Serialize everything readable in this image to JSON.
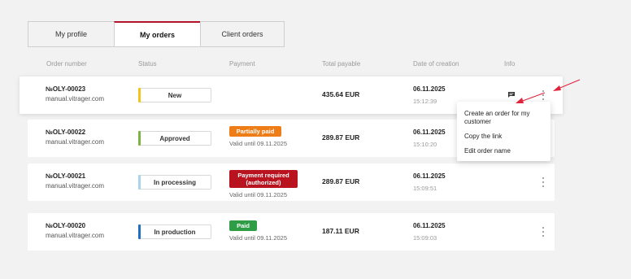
{
  "tabs": [
    "My profile",
    "My orders",
    "Client orders"
  ],
  "columns": [
    "Order number",
    "Status",
    "Payment",
    "Total payable",
    "Date of creation",
    "Info"
  ],
  "orders": [
    {
      "number": "№OLY-00023",
      "site": "manual.vitrager.com",
      "status": "New",
      "status_color": "#f0c419",
      "payment_label": "",
      "payment_color": "",
      "valid_until": "",
      "total": "435.64 EUR",
      "date": "06.11.2025",
      "time": "15:12:39"
    },
    {
      "number": "№OLY-00022",
      "site": "manual.vitrager.com",
      "status": "Approved",
      "status_color": "#7cb342",
      "payment_label": "Partially paid",
      "payment_color": "#ef7d17",
      "valid_until": "Valid until 09.11.2025",
      "total": "289.87 EUR",
      "date": "06.11.2025",
      "time": "15:10:20"
    },
    {
      "number": "№OLY-00021",
      "site": "manual.vitrager.com",
      "status": "In processing",
      "status_color": "#a9d4ea",
      "payment_label": "Payment required (authorized)",
      "payment_color": "#b8131f",
      "valid_until": "Valid until 09.11.2025",
      "total": "289.87 EUR",
      "date": "06.11.2025",
      "time": "15:09:51"
    },
    {
      "number": "№OLY-00020",
      "site": "manual.vitrager.com",
      "status": "In production",
      "status_color": "#1f6fc0",
      "payment_label": "Paid",
      "payment_color": "#2e9d46",
      "valid_until": "Valid until 09.11.2025",
      "total": "187.11 EUR",
      "date": "06.11.2025",
      "time": "15:09:03"
    }
  ],
  "context_menu": [
    "Create an order for my customer",
    "Copy the link",
    "Edit order name"
  ],
  "icons": {
    "info": "chat-icon",
    "more": "kebab-menu-icon",
    "annotation": "red-arrow-icon"
  },
  "colors": {
    "accent": "#b5122b",
    "annotation_arrow": "#e0223a"
  }
}
